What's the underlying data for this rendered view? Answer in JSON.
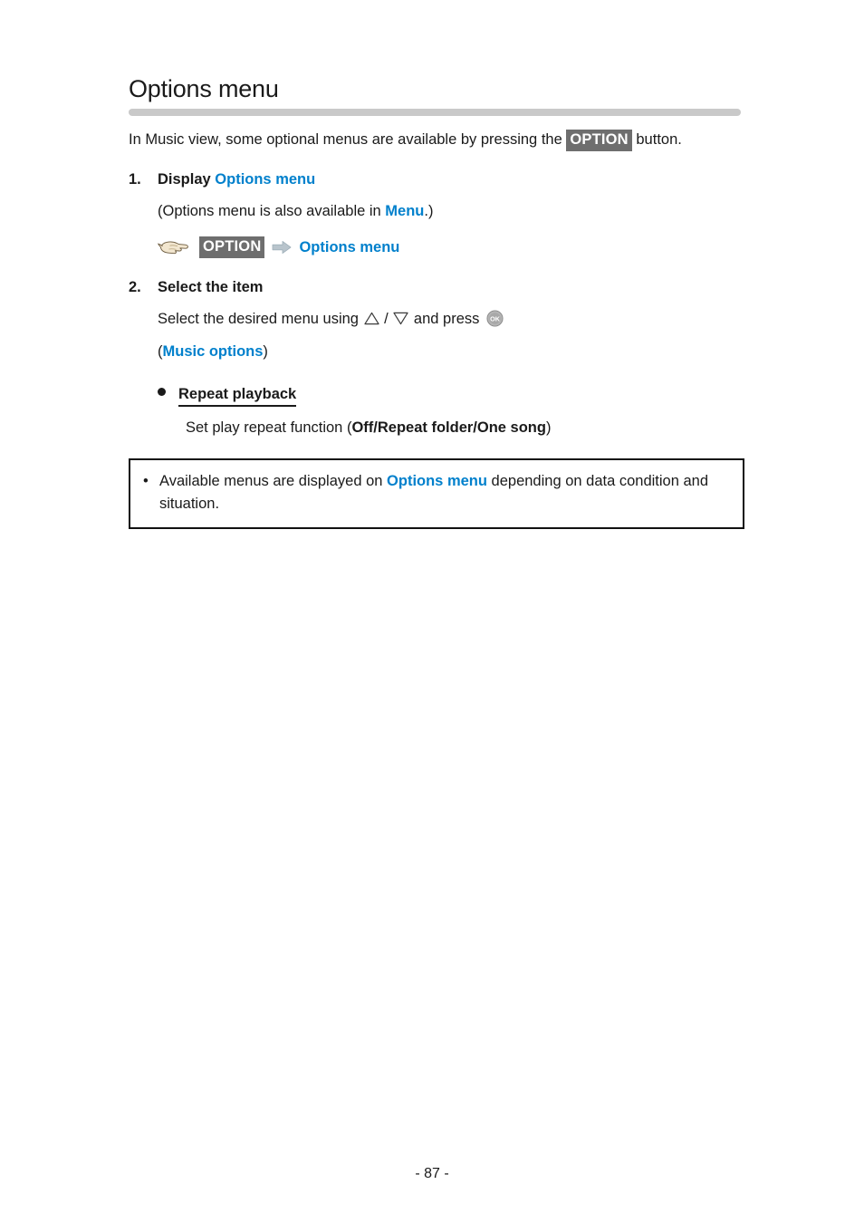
{
  "document": {
    "title": "Options menu",
    "footer_page_label": "- 87 -"
  },
  "intro": {
    "text_before": "In Music view, some optional menus are available by pressing the ",
    "key_label": "OPTION",
    "text_after": " button."
  },
  "steps": [
    {
      "number": "1.",
      "head_prefix": "Display ",
      "head_link": "Options menu",
      "note_before": "(Options menu is also available in ",
      "note_link": "Menu",
      "note_after": ".)",
      "operation": {
        "hand_icon": "pointing-hand-icon",
        "key_label": "OPTION",
        "arrow_icon": "right-arrow-icon",
        "target_label": "Options menu"
      }
    },
    {
      "number": "2.",
      "head_text": "Select the item",
      "line_before": "Select the desired menu using ",
      "up_icon": "triangle-up-icon",
      "separator": " / ",
      "down_icon": "triangle-down-icon",
      "line_middle": " and press ",
      "ok_icon": "ok-button-icon",
      "paren_open": "(",
      "paren_link": "Music options",
      "paren_close": ")",
      "sub_items": [
        {
          "bullet_icon": "filled-disc-bullet",
          "title": "Repeat playback",
          "desc_before": "Set play repeat function (",
          "desc_options": "Off/Repeat folder/One song",
          "desc_after": ")"
        }
      ]
    }
  ],
  "note_box": {
    "bullet": "•",
    "text_before": "Available menus are displayed on ",
    "link": "Options menu",
    "text_after": " depending on data condition and situation."
  },
  "colors": {
    "link_blue": "#0080cc",
    "keycap_bg": "#6e6e6e",
    "rule_gray": "#c9c9c9",
    "text": "#1a1a1a",
    "note_border": "#111111"
  }
}
